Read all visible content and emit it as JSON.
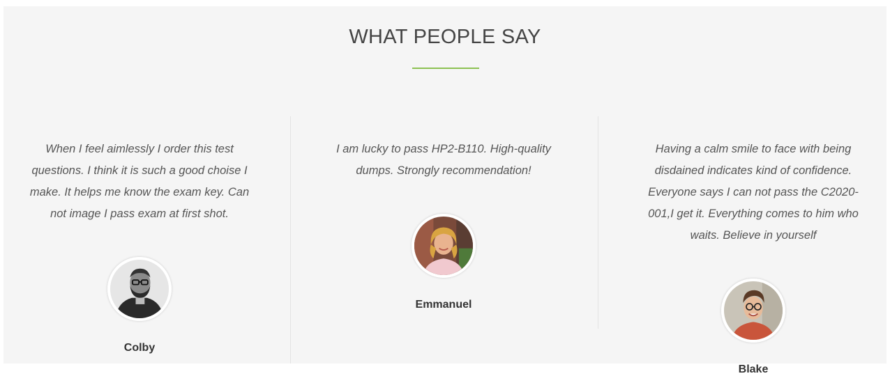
{
  "section": {
    "title": "WHAT PEOPLE SAY"
  },
  "testimonials": [
    {
      "quote": "When I feel aimlessly I order this test questions. I think it is such a good choise I make. It helps me know the exam key. Can not image I pass exam at first shot.",
      "name": "Colby"
    },
    {
      "quote": "I am lucky to pass HP2-B110. High-quality dumps. Strongly recommendation!",
      "name": "Emmanuel"
    },
    {
      "quote": "Having a calm smile to face with being disdained indicates kind of confidence. Everyone says I can not pass the C2020-001,I get it. Everything comes to him who waits. Believe in yourself",
      "name": "Blake"
    }
  ],
  "colors": {
    "background": "#f5f5f5",
    "accent": "#8cc152",
    "text": "#555555"
  }
}
